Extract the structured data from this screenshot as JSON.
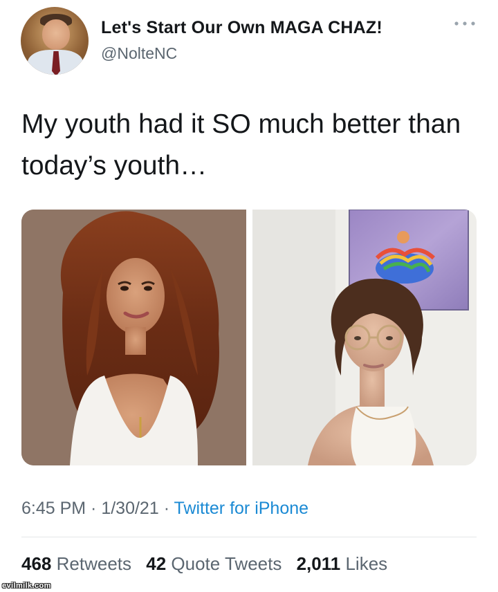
{
  "user": {
    "display_name": "Let's Start Our Own MAGA CHAZ!",
    "handle": "@NolteNC",
    "avatar_icon": "profile-photo"
  },
  "header": {
    "more_icon": "more-options-icon"
  },
  "tweet": {
    "line1": "My youth had it SO much better than",
    "line2": "today’s youth…"
  },
  "media": {
    "count": 2,
    "images": [
      {
        "name": "photo-left"
      },
      {
        "name": "photo-right"
      }
    ]
  },
  "meta": {
    "time": "6:45 PM",
    "sep1": " · ",
    "date": "1/30/21",
    "sep2": " · ",
    "source": "Twitter for iPhone"
  },
  "stats": {
    "retweets_count": "468",
    "retweets_label": "Retweets",
    "quotes_count": "42",
    "quotes_label": "Quote Tweets",
    "likes_count": "2,011",
    "likes_label": "Likes"
  },
  "watermark": "evilmilk.com",
  "colors": {
    "link": "#1b8ad4",
    "secondary_text": "#5b6670",
    "primary_text": "#14171a",
    "divider": "#e3e6e8"
  }
}
